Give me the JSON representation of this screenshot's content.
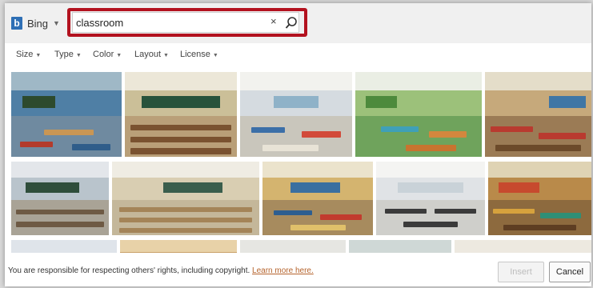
{
  "search": {
    "source_label": "Bing",
    "query": "classroom",
    "clear_glyph": "×",
    "icons": [
      "bing-logo-icon",
      "chevron-down-icon",
      "clear-icon",
      "search-icon"
    ]
  },
  "filters": [
    {
      "label": "Size"
    },
    {
      "label": "Type"
    },
    {
      "label": "Color"
    },
    {
      "label": "Layout"
    },
    {
      "label": "License"
    }
  ],
  "footer": {
    "notice": "You are responsible for respecting others' rights, including copyright.",
    "learn_more": "Learn more here.",
    "insert_label": "Insert",
    "cancel_label": "Cancel"
  },
  "colors": {
    "highlight_border": "#b3121f",
    "link": "#b5632c",
    "bing_blue": "#2e6fb5"
  }
}
